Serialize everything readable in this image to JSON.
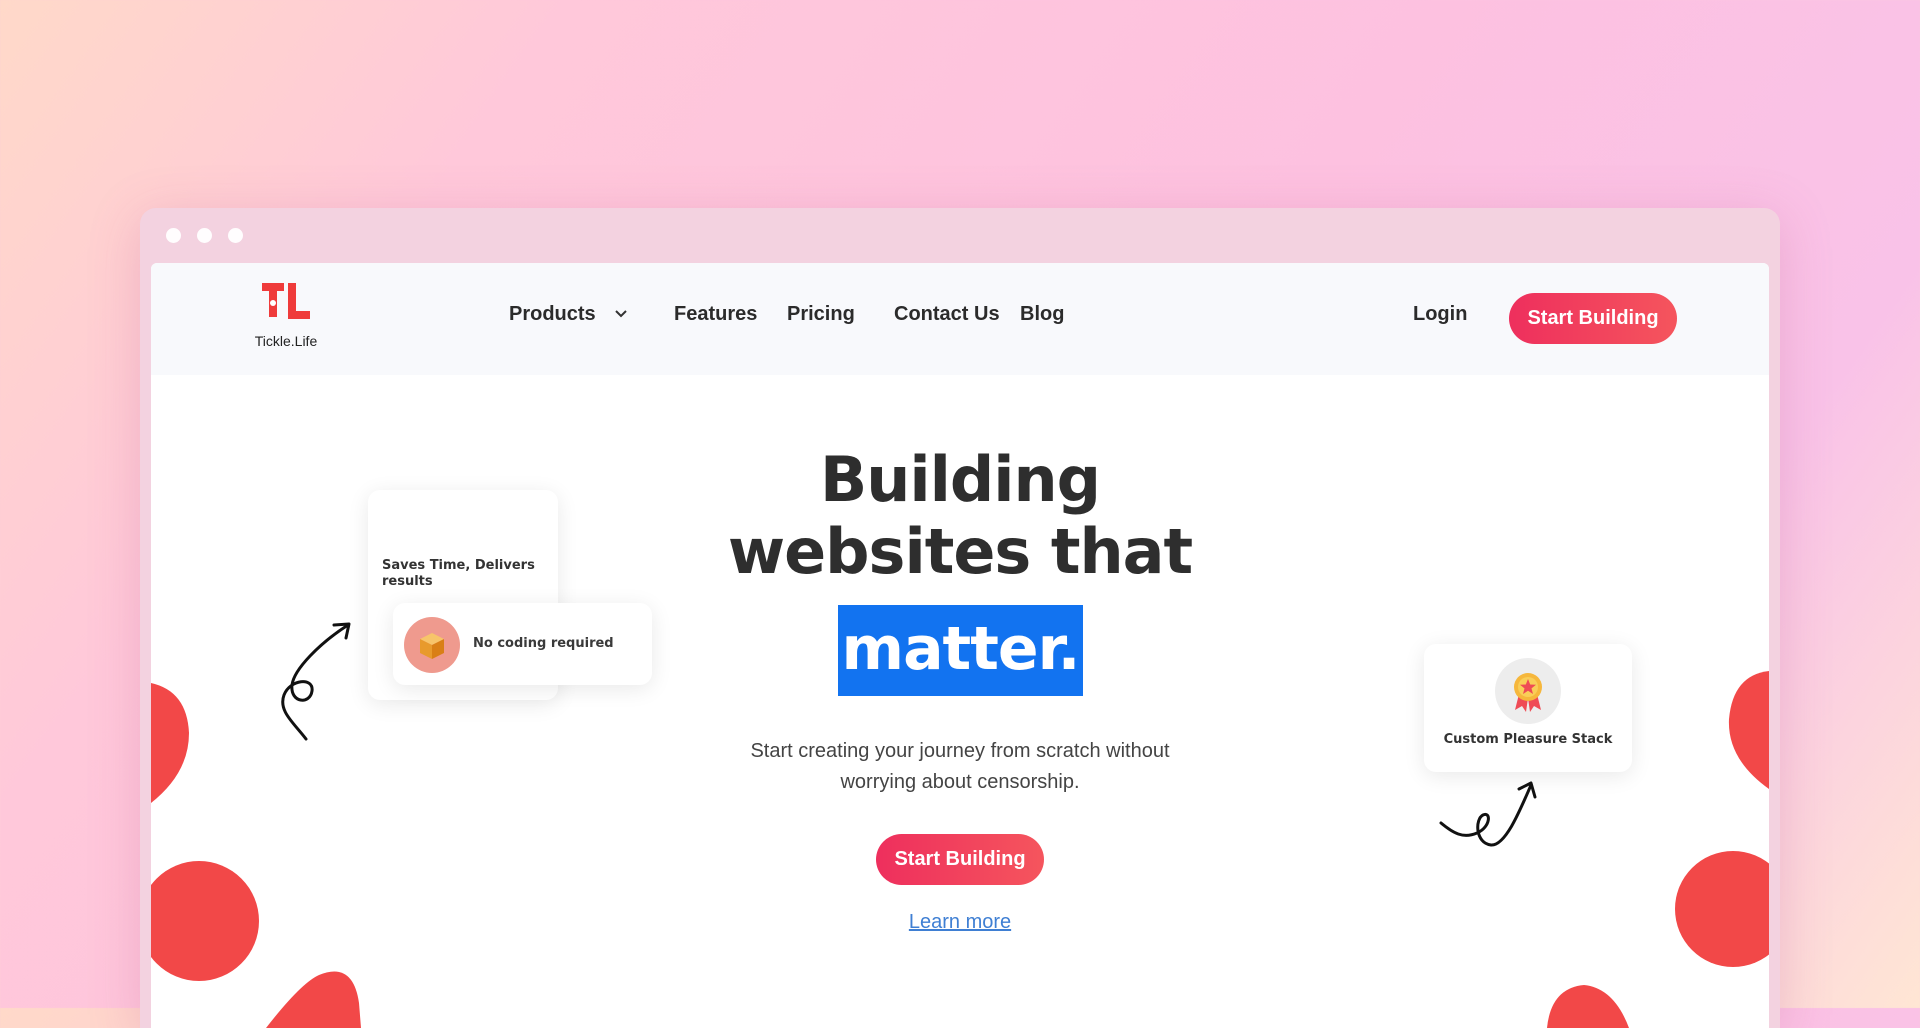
{
  "colors": {
    "accent": "#F0365E",
    "highlight": "#1273F0",
    "decor": "#F24848",
    "link": "#3F7FD3"
  },
  "brand": {
    "name": "Tickle.Life"
  },
  "nav": {
    "items": [
      {
        "label": "Products",
        "has_dropdown": true
      },
      {
        "label": "Features"
      },
      {
        "label": "Pricing"
      },
      {
        "label": "Contact Us"
      },
      {
        "label": "Blog"
      }
    ],
    "login_label": "Login",
    "cta_label": "Start Building"
  },
  "hero": {
    "title_line1": "Building",
    "title_line2": "websites that",
    "title_highlight": "matter.",
    "subtitle": "Start creating your journey from scratch without worrying about censorship.",
    "cta_label": "Start Building",
    "learn_more_label": "Learn more"
  },
  "cards": {
    "saves": {
      "text": "Saves Time, Delivers results"
    },
    "nocode": {
      "text": "No coding required",
      "icon": "box-icon"
    },
    "pleasure": {
      "text": "Custom Pleasure Stack",
      "icon": "award-ribbon-icon"
    }
  }
}
